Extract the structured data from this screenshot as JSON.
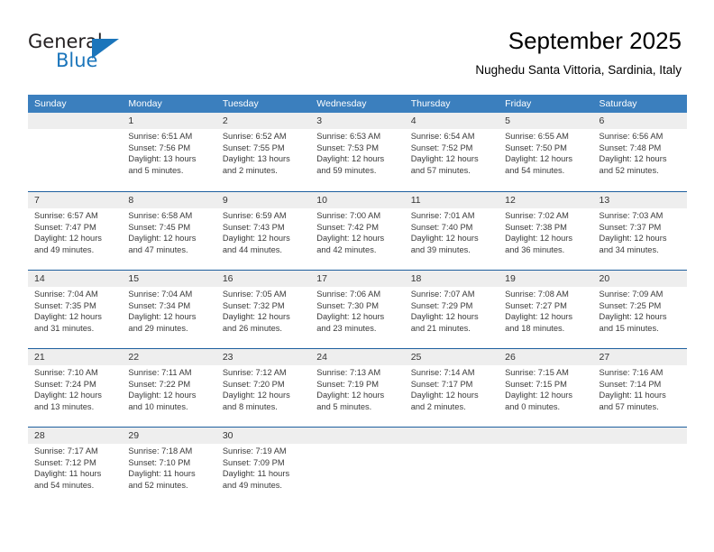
{
  "brand": {
    "name_part1": "General",
    "name_part2": "Blue",
    "accent_color": "#1b75bb"
  },
  "header": {
    "title": "September 2025",
    "subtitle": "Nughedu Santa Vittoria, Sardinia, Italy"
  },
  "calendar": {
    "header_bg": "#3b7fbe",
    "row_rule_color": "#1e5f9e",
    "daynum_band_color": "#eeeeee",
    "weekdays": [
      "Sunday",
      "Monday",
      "Tuesday",
      "Wednesday",
      "Thursday",
      "Friday",
      "Saturday"
    ],
    "weeks": [
      [
        {
          "day": "",
          "empty": true
        },
        {
          "day": "1",
          "sunrise": "Sunrise: 6:51 AM",
          "sunset": "Sunset: 7:56 PM",
          "daylight_line1": "Daylight: 13 hours",
          "daylight_line2": "and 5 minutes."
        },
        {
          "day": "2",
          "sunrise": "Sunrise: 6:52 AM",
          "sunset": "Sunset: 7:55 PM",
          "daylight_line1": "Daylight: 13 hours",
          "daylight_line2": "and 2 minutes."
        },
        {
          "day": "3",
          "sunrise": "Sunrise: 6:53 AM",
          "sunset": "Sunset: 7:53 PM",
          "daylight_line1": "Daylight: 12 hours",
          "daylight_line2": "and 59 minutes."
        },
        {
          "day": "4",
          "sunrise": "Sunrise: 6:54 AM",
          "sunset": "Sunset: 7:52 PM",
          "daylight_line1": "Daylight: 12 hours",
          "daylight_line2": "and 57 minutes."
        },
        {
          "day": "5",
          "sunrise": "Sunrise: 6:55 AM",
          "sunset": "Sunset: 7:50 PM",
          "daylight_line1": "Daylight: 12 hours",
          "daylight_line2": "and 54 minutes."
        },
        {
          "day": "6",
          "sunrise": "Sunrise: 6:56 AM",
          "sunset": "Sunset: 7:48 PM",
          "daylight_line1": "Daylight: 12 hours",
          "daylight_line2": "and 52 minutes."
        }
      ],
      [
        {
          "day": "7",
          "sunrise": "Sunrise: 6:57 AM",
          "sunset": "Sunset: 7:47 PM",
          "daylight_line1": "Daylight: 12 hours",
          "daylight_line2": "and 49 minutes."
        },
        {
          "day": "8",
          "sunrise": "Sunrise: 6:58 AM",
          "sunset": "Sunset: 7:45 PM",
          "daylight_line1": "Daylight: 12 hours",
          "daylight_line2": "and 47 minutes."
        },
        {
          "day": "9",
          "sunrise": "Sunrise: 6:59 AM",
          "sunset": "Sunset: 7:43 PM",
          "daylight_line1": "Daylight: 12 hours",
          "daylight_line2": "and 44 minutes."
        },
        {
          "day": "10",
          "sunrise": "Sunrise: 7:00 AM",
          "sunset": "Sunset: 7:42 PM",
          "daylight_line1": "Daylight: 12 hours",
          "daylight_line2": "and 42 minutes."
        },
        {
          "day": "11",
          "sunrise": "Sunrise: 7:01 AM",
          "sunset": "Sunset: 7:40 PM",
          "daylight_line1": "Daylight: 12 hours",
          "daylight_line2": "and 39 minutes."
        },
        {
          "day": "12",
          "sunrise": "Sunrise: 7:02 AM",
          "sunset": "Sunset: 7:38 PM",
          "daylight_line1": "Daylight: 12 hours",
          "daylight_line2": "and 36 minutes."
        },
        {
          "day": "13",
          "sunrise": "Sunrise: 7:03 AM",
          "sunset": "Sunset: 7:37 PM",
          "daylight_line1": "Daylight: 12 hours",
          "daylight_line2": "and 34 minutes."
        }
      ],
      [
        {
          "day": "14",
          "sunrise": "Sunrise: 7:04 AM",
          "sunset": "Sunset: 7:35 PM",
          "daylight_line1": "Daylight: 12 hours",
          "daylight_line2": "and 31 minutes."
        },
        {
          "day": "15",
          "sunrise": "Sunrise: 7:04 AM",
          "sunset": "Sunset: 7:34 PM",
          "daylight_line1": "Daylight: 12 hours",
          "daylight_line2": "and 29 minutes."
        },
        {
          "day": "16",
          "sunrise": "Sunrise: 7:05 AM",
          "sunset": "Sunset: 7:32 PM",
          "daylight_line1": "Daylight: 12 hours",
          "daylight_line2": "and 26 minutes."
        },
        {
          "day": "17",
          "sunrise": "Sunrise: 7:06 AM",
          "sunset": "Sunset: 7:30 PM",
          "daylight_line1": "Daylight: 12 hours",
          "daylight_line2": "and 23 minutes."
        },
        {
          "day": "18",
          "sunrise": "Sunrise: 7:07 AM",
          "sunset": "Sunset: 7:29 PM",
          "daylight_line1": "Daylight: 12 hours",
          "daylight_line2": "and 21 minutes."
        },
        {
          "day": "19",
          "sunrise": "Sunrise: 7:08 AM",
          "sunset": "Sunset: 7:27 PM",
          "daylight_line1": "Daylight: 12 hours",
          "daylight_line2": "and 18 minutes."
        },
        {
          "day": "20",
          "sunrise": "Sunrise: 7:09 AM",
          "sunset": "Sunset: 7:25 PM",
          "daylight_line1": "Daylight: 12 hours",
          "daylight_line2": "and 15 minutes."
        }
      ],
      [
        {
          "day": "21",
          "sunrise": "Sunrise: 7:10 AM",
          "sunset": "Sunset: 7:24 PM",
          "daylight_line1": "Daylight: 12 hours",
          "daylight_line2": "and 13 minutes."
        },
        {
          "day": "22",
          "sunrise": "Sunrise: 7:11 AM",
          "sunset": "Sunset: 7:22 PM",
          "daylight_line1": "Daylight: 12 hours",
          "daylight_line2": "and 10 minutes."
        },
        {
          "day": "23",
          "sunrise": "Sunrise: 7:12 AM",
          "sunset": "Sunset: 7:20 PM",
          "daylight_line1": "Daylight: 12 hours",
          "daylight_line2": "and 8 minutes."
        },
        {
          "day": "24",
          "sunrise": "Sunrise: 7:13 AM",
          "sunset": "Sunset: 7:19 PM",
          "daylight_line1": "Daylight: 12 hours",
          "daylight_line2": "and 5 minutes."
        },
        {
          "day": "25",
          "sunrise": "Sunrise: 7:14 AM",
          "sunset": "Sunset: 7:17 PM",
          "daylight_line1": "Daylight: 12 hours",
          "daylight_line2": "and 2 minutes."
        },
        {
          "day": "26",
          "sunrise": "Sunrise: 7:15 AM",
          "sunset": "Sunset: 7:15 PM",
          "daylight_line1": "Daylight: 12 hours",
          "daylight_line2": "and 0 minutes."
        },
        {
          "day": "27",
          "sunrise": "Sunrise: 7:16 AM",
          "sunset": "Sunset: 7:14 PM",
          "daylight_line1": "Daylight: 11 hours",
          "daylight_line2": "and 57 minutes."
        }
      ],
      [
        {
          "day": "28",
          "sunrise": "Sunrise: 7:17 AM",
          "sunset": "Sunset: 7:12 PM",
          "daylight_line1": "Daylight: 11 hours",
          "daylight_line2": "and 54 minutes."
        },
        {
          "day": "29",
          "sunrise": "Sunrise: 7:18 AM",
          "sunset": "Sunset: 7:10 PM",
          "daylight_line1": "Daylight: 11 hours",
          "daylight_line2": "and 52 minutes."
        },
        {
          "day": "30",
          "sunrise": "Sunrise: 7:19 AM",
          "sunset": "Sunset: 7:09 PM",
          "daylight_line1": "Daylight: 11 hours",
          "daylight_line2": "and 49 minutes."
        },
        {
          "day": "",
          "empty": true
        },
        {
          "day": "",
          "empty": true
        },
        {
          "day": "",
          "empty": true
        },
        {
          "day": "",
          "empty": true
        }
      ]
    ]
  }
}
